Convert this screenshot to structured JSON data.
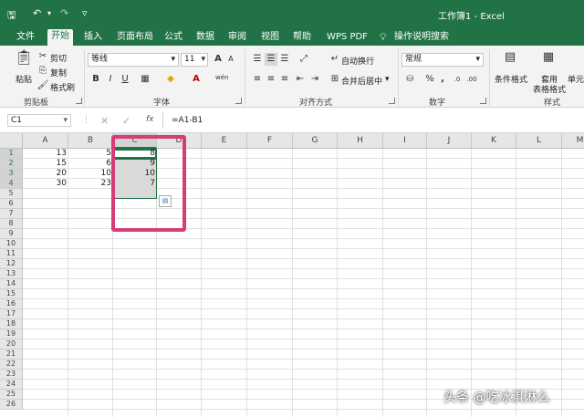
{
  "titlebar": {
    "title": "工作簿1  -  Excel",
    "qa_save": "🖫",
    "qa_undo": "↶",
    "qa_redo": "↷",
    "qa_more": "▿"
  },
  "tabs": [
    "文件",
    "开始",
    "插入",
    "页面布局",
    "公式",
    "数据",
    "审阅",
    "视图",
    "帮助",
    "WPS PDF",
    "操作说明搜索"
  ],
  "ribbon": {
    "clipboard": {
      "paste": "粘贴",
      "cut": "剪切",
      "copy": "复制",
      "format_painter": "格式刷",
      "label": "剪贴板"
    },
    "font": {
      "name": "等线",
      "size": "11",
      "grow": "A",
      "shrink": "A",
      "bold": "B",
      "italic": "I",
      "underline": "U",
      "wen": "wén",
      "label": "字体"
    },
    "alignment": {
      "wrap": "自动换行",
      "merge": "合并后居中",
      "label": "对齐方式"
    },
    "number": {
      "format": "常规",
      "percent": "%",
      "comma": ",",
      "label": "数字"
    },
    "styles": {
      "conditional": "条件格式",
      "table_line1": "套用",
      "table_line2": "表格格式",
      "cell_styles": "单元",
      "label": "样式"
    }
  },
  "formula_bar": {
    "name_box": "C1",
    "fx": "fx",
    "formula": "=A1-B1"
  },
  "grid": {
    "columns": [
      "A",
      "B",
      "C",
      "D",
      "E",
      "F",
      "G",
      "H",
      "I",
      "J",
      "K",
      "L",
      "M"
    ],
    "rows": [
      "1",
      "2",
      "3",
      "4",
      "5",
      "6",
      "7",
      "8",
      "9",
      "10",
      "11",
      "12",
      "13",
      "14",
      "15",
      "16",
      "17",
      "18",
      "19",
      "20",
      "21",
      "22",
      "23",
      "24",
      "25",
      "26"
    ],
    "colA": [
      "13",
      "15",
      "20",
      "30"
    ],
    "colB": [
      "5",
      "6",
      "10",
      "23"
    ],
    "colC": [
      "8",
      "9",
      "10",
      "7"
    ]
  },
  "watermark": "头条 @吃冰淇淋么",
  "colors": {
    "accent": "#217346",
    "highlight": "#d63d78"
  }
}
